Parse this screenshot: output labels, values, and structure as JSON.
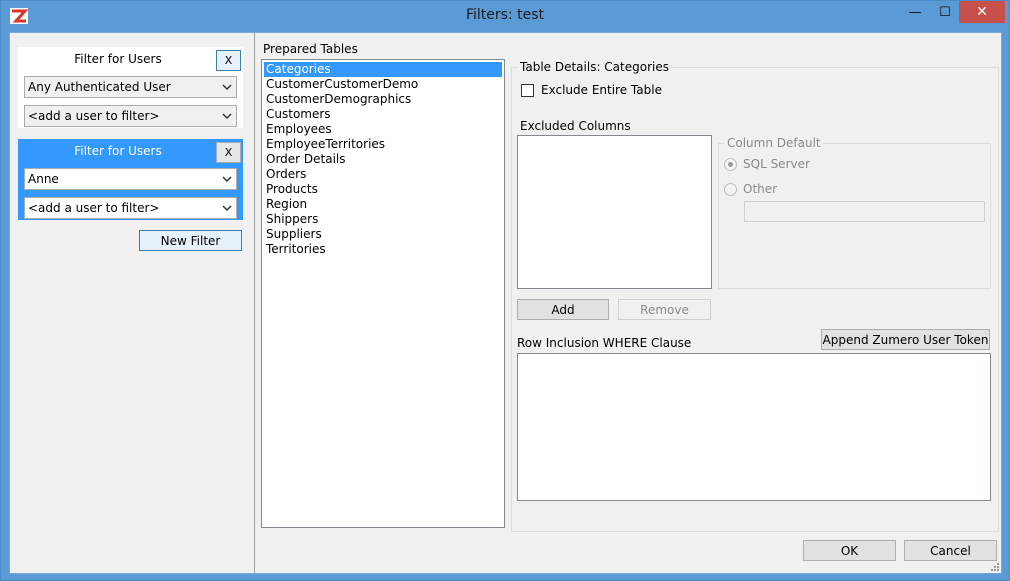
{
  "window": {
    "title": "Filters: test",
    "min_glyph": "—",
    "max_glyph": "☐",
    "close_glyph": "✕"
  },
  "filters": [
    {
      "title": "Filter for Users",
      "remove_label": "X",
      "user_select": "Any Authenticated User",
      "add_select": "<add a user to filter>",
      "selected": false
    },
    {
      "title": "Filter for Users",
      "remove_label": "X",
      "user_select": "Anne",
      "add_select": "<add a user to filter>",
      "selected": true
    }
  ],
  "new_filter_label": "New Filter",
  "prepared_tables": {
    "label": "Prepared Tables",
    "items": [
      "Categories",
      "CustomerCustomerDemo",
      "CustomerDemographics",
      "Customers",
      "Employees",
      "EmployeeTerritories",
      "Order Details",
      "Orders",
      "Products",
      "Region",
      "Shippers",
      "Suppliers",
      "Territories"
    ],
    "selected_index": 0
  },
  "details": {
    "legend": "Table Details: Categories",
    "exclude_label": "Exclude Entire Table",
    "excluded_columns_label": "Excluded Columns",
    "column_default": {
      "legend": "Column Default",
      "option_sql": "SQL Server",
      "option_other": "Other",
      "other_value": ""
    },
    "add_label": "Add",
    "remove_label": "Remove",
    "append_label": "Append Zumero User Token",
    "where_label": "Row Inclusion WHERE Clause",
    "where_value": ""
  },
  "footer": {
    "ok_label": "OK",
    "cancel_label": "Cancel"
  },
  "colors": {
    "frame": "#5b9bd5",
    "selection": "#3399ff",
    "close": "#c7504b"
  }
}
